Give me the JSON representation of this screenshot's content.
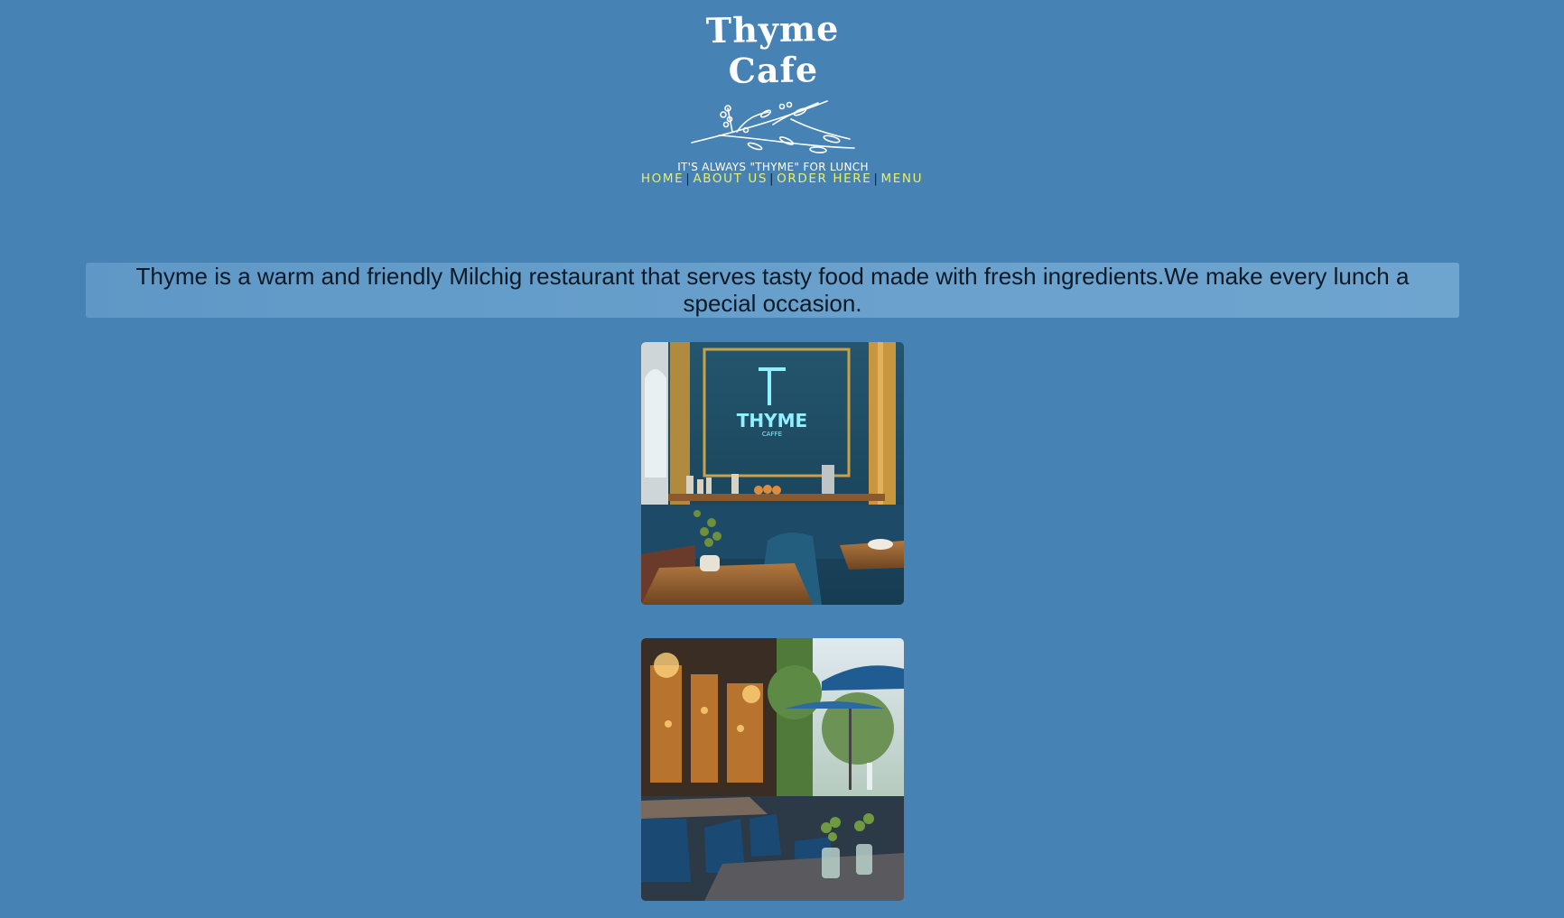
{
  "brand": {
    "name": "Thyme Cafe",
    "tagline": "IT'S ALWAYS \"THYME\" FOR LUNCH"
  },
  "nav": {
    "items": [
      "HOME",
      "ABOUT US",
      "ORDER HERE",
      "MENU"
    ]
  },
  "intro": {
    "text": "Thyme is a warm and friendly Milchig restaurant that serves tasty food made with fresh ingredients.We make every lunch a special occasion."
  },
  "photos": {
    "interior_sign_line1": "THYME",
    "interior_sign_line2": "CAFFE"
  },
  "colors": {
    "background": "#4682b4",
    "nav_link": "#e6ef6e",
    "intro_text": "#0d1a26"
  }
}
